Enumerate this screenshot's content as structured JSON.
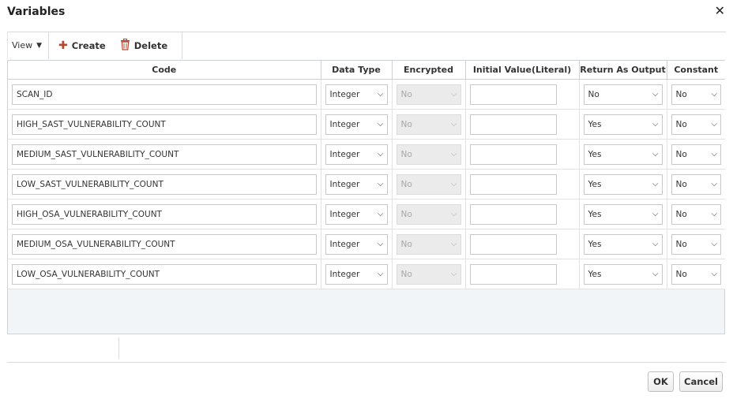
{
  "dialog": {
    "title": "Variables",
    "close_symbol": "✕"
  },
  "toolbar": {
    "view_label": "View",
    "create_label": "Create",
    "delete_label": "Delete"
  },
  "columns": [
    "Code",
    "Data Type",
    "Encrypted",
    "Initial Value(Literal)",
    "Return As Output",
    "Constant"
  ],
  "rows": [
    {
      "code": "SCAN_ID",
      "data_type": "Integer",
      "encrypted": "No",
      "initial_value": "",
      "return_as_output": "No",
      "constant": "No"
    },
    {
      "code": "HIGH_SAST_VULNERABILITY_COUNT",
      "data_type": "Integer",
      "encrypted": "No",
      "initial_value": "",
      "return_as_output": "Yes",
      "constant": "No"
    },
    {
      "code": "MEDIUM_SAST_VULNERABILITY_COUNT",
      "data_type": "Integer",
      "encrypted": "No",
      "initial_value": "",
      "return_as_output": "Yes",
      "constant": "No"
    },
    {
      "code": "LOW_SAST_VULNERABILITY_COUNT",
      "data_type": "Integer",
      "encrypted": "No",
      "initial_value": "",
      "return_as_output": "Yes",
      "constant": "No"
    },
    {
      "code": "HIGH_OSA_VULNERABILITY_COUNT",
      "data_type": "Integer",
      "encrypted": "No",
      "initial_value": "",
      "return_as_output": "Yes",
      "constant": "No"
    },
    {
      "code": "MEDIUM_OSA_VULNERABILITY_COUNT",
      "data_type": "Integer",
      "encrypted": "No",
      "initial_value": "",
      "return_as_output": "Yes",
      "constant": "No"
    },
    {
      "code": "LOW_OSA_VULNERABILITY_COUNT",
      "data_type": "Integer",
      "encrypted": "No",
      "initial_value": "",
      "return_as_output": "Yes",
      "constant": "No"
    }
  ],
  "footer": {
    "ok_label": "OK",
    "cancel_label": "Cancel"
  }
}
